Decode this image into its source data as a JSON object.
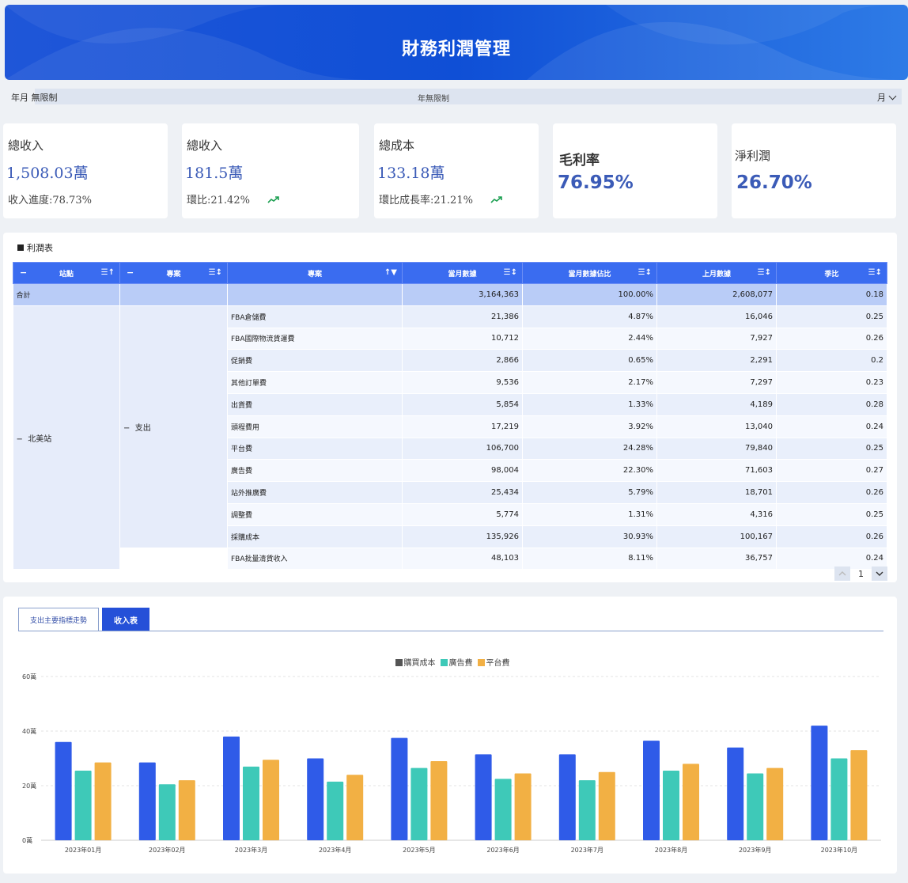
{
  "header": {
    "title": "財務利潤管理"
  },
  "filter": {
    "label": "年月 無限制",
    "value": "年無限制",
    "unit": "月"
  },
  "kpis": [
    {
      "title": "總收入",
      "value": "1,508.03萬",
      "sub": "收入進度:78.73%"
    },
    {
      "title": "總收入",
      "value": "181.5萬",
      "sub": "環比:21.42%",
      "trend_color": "#1a9e50"
    },
    {
      "title": "總成本",
      "value": "133.18萬",
      "sub": "環比成長率:21.21%",
      "trend_color": "#1a9e50"
    },
    {
      "title": "毛利率",
      "value": "76.95%"
    },
    {
      "title": "淨利潤",
      "value": "26.70%"
    }
  ],
  "profit_table": {
    "title": "利潤表",
    "columns": [
      "站點",
      "專案",
      "專案",
      "當月數據",
      "當月數據佔比",
      "上月數據",
      "季比"
    ],
    "total": {
      "label": "合計",
      "current": "3,164,363",
      "ratio": "100.00%",
      "last": "2,608,077",
      "qoq": "0.18"
    },
    "site": "北美站",
    "group": "支出",
    "rows": [
      {
        "item": "FBA倉儲費",
        "current": "21,386",
        "ratio": "4.87%",
        "last": "16,046",
        "qoq": "0.25"
      },
      {
        "item": "FBA國際物流貨運費",
        "current": "10,712",
        "ratio": "2.44%",
        "last": "7,927",
        "qoq": "0.26"
      },
      {
        "item": "促銷費",
        "current": "2,866",
        "ratio": "0.65%",
        "last": "2,291",
        "qoq": "0.2"
      },
      {
        "item": "其他訂單費",
        "current": "9,536",
        "ratio": "2.17%",
        "last": "7,297",
        "qoq": "0.23"
      },
      {
        "item": "出貨費",
        "current": "5,854",
        "ratio": "1.33%",
        "last": "4,189",
        "qoq": "0.28"
      },
      {
        "item": "頭程費用",
        "current": "17,219",
        "ratio": "3.92%",
        "last": "13,040",
        "qoq": "0.24"
      },
      {
        "item": "平台費",
        "current": "106,700",
        "ratio": "24.28%",
        "last": "79,840",
        "qoq": "0.25"
      },
      {
        "item": "廣告費",
        "current": "98,004",
        "ratio": "22.30%",
        "last": "71,603",
        "qoq": "0.27"
      },
      {
        "item": "站外推廣費",
        "current": "25,434",
        "ratio": "5.79%",
        "last": "18,701",
        "qoq": "0.26"
      },
      {
        "item": "調整費",
        "current": "5,774",
        "ratio": "1.31%",
        "last": "4,316",
        "qoq": "0.25"
      },
      {
        "item": "採購成本",
        "current": "135,926",
        "ratio": "30.93%",
        "last": "100,167",
        "qoq": "0.26"
      }
    ],
    "extra_row": {
      "item": "FBA批量清貨收入",
      "current": "48,103",
      "ratio": "8.11%",
      "last": "36,757",
      "qoq": "0.24"
    },
    "page": "1"
  },
  "chart_panel": {
    "tabs": [
      "支出主要指標走勢",
      "收入表"
    ],
    "active_tab": 1
  },
  "chart_data": {
    "type": "bar",
    "categories": [
      "2023年01月",
      "2023年02月",
      "2023年3月",
      "2023年4月",
      "2023年5月",
      "2023年6月",
      "2023年7月",
      "2023年8月",
      "2023年9月",
      "2023年10月"
    ],
    "series": [
      {
        "name": "購買成本",
        "color": "#2f5be8",
        "values": [
          36,
          28.5,
          38,
          30,
          37.5,
          31.5,
          31.5,
          36.5,
          34,
          42
        ]
      },
      {
        "name": "廣告費",
        "color": "#3ec9b8",
        "values": [
          25.5,
          20.5,
          27,
          21.5,
          26.5,
          22.5,
          22,
          25.5,
          24.5,
          30
        ]
      },
      {
        "name": "平台費",
        "color": "#f2b044",
        "values": [
          28.5,
          22,
          29.5,
          24,
          29,
          24.5,
          25,
          28,
          26.5,
          33
        ]
      }
    ],
    "legend_swatch_colors": [
      "#555555",
      "#3ec9b8",
      "#f2b044"
    ],
    "y_ticks": [
      "0萬",
      "20萬",
      "40萬",
      "60萬"
    ],
    "ylim": [
      0,
      60
    ],
    "grid": true,
    "legend": "top-center"
  }
}
